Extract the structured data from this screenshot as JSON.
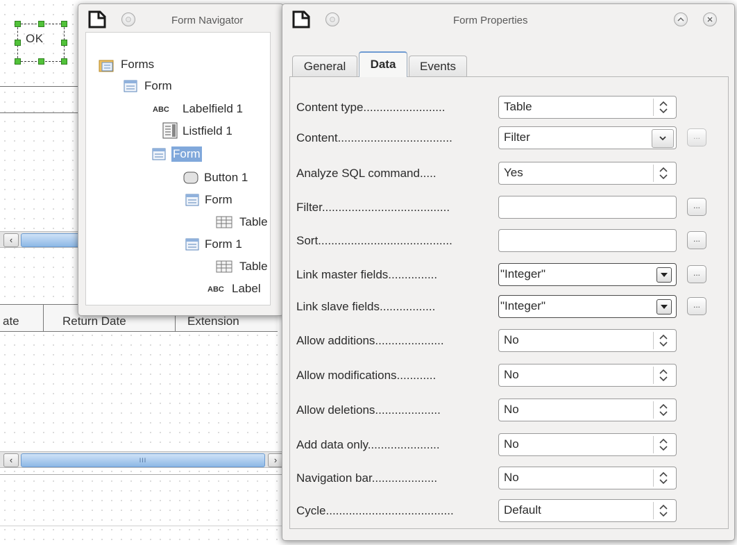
{
  "background": {
    "ok_button_label": "OK",
    "column_headers": [
      "ate",
      "Return Date",
      "Extension"
    ],
    "scrollbar_grip": "III"
  },
  "navigator": {
    "title": "Form Navigator",
    "tree": [
      {
        "label": "Forms",
        "icon": "forms-folder-icon",
        "depth": 0
      },
      {
        "label": "Form",
        "icon": "form-icon",
        "depth": 1,
        "expanded": true
      },
      {
        "label": "Labelfield 1",
        "icon": "label-abc-icon",
        "depth": 2
      },
      {
        "label": "Listfield 1",
        "icon": "listbox-icon",
        "depth": 2
      },
      {
        "label": "Form",
        "icon": "form-icon",
        "depth": 2,
        "expanded": true,
        "selected": true
      },
      {
        "label": "Button 1",
        "icon": "button-icon",
        "depth": 3
      },
      {
        "label": "Form",
        "icon": "form-icon",
        "depth": 3,
        "expanded": true
      },
      {
        "label": "Table",
        "icon": "table-icon",
        "depth": 4
      },
      {
        "label": "Form 1",
        "icon": "form-icon",
        "depth": 3,
        "expanded": true
      },
      {
        "label": "Table",
        "icon": "table-icon",
        "depth": 4
      },
      {
        "label": "Label",
        "icon": "label-abc-icon",
        "depth": 4
      }
    ],
    "abc_text": "ABC"
  },
  "properties": {
    "title": "Form Properties",
    "tabs": [
      "General",
      "Data",
      "Events"
    ],
    "active_tab": "Data",
    "rows": [
      {
        "label": "Content type.........................",
        "value": "Table",
        "control": "spin"
      },
      {
        "label": "Content...................................",
        "value": "Filter",
        "control": "dropdown",
        "button": "..."
      },
      {
        "label": "Analyze SQL command.....",
        "value": "Yes",
        "control": "spin"
      },
      {
        "label": "Filter.......................................",
        "value": "",
        "control": "text",
        "button": "..."
      },
      {
        "label": "Sort.........................................",
        "value": "",
        "control": "text",
        "button": "..."
      },
      {
        "label": "Link master fields...............",
        "value": "\"Integer\"",
        "control": "combo",
        "button": "..."
      },
      {
        "label": "Link slave fields.................",
        "value": "\"Integer\"",
        "control": "combo",
        "button": "..."
      },
      {
        "label": "Allow additions.....................",
        "value": "No",
        "control": "spin"
      },
      {
        "label": "Allow modifications............",
        "value": "No",
        "control": "spin"
      },
      {
        "label": "Allow deletions....................",
        "value": "No",
        "control": "spin"
      },
      {
        "label": "Add data only......................",
        "value": "No",
        "control": "spin"
      },
      {
        "label": "Navigation bar....................",
        "value": "No",
        "control": "spin"
      },
      {
        "label": "Cycle.......................................",
        "value": "Default",
        "control": "spin"
      }
    ]
  },
  "colors": {
    "selection": "#80a8db",
    "handle_green": "#52c23a",
    "window_bg": "#f2f1f0"
  }
}
